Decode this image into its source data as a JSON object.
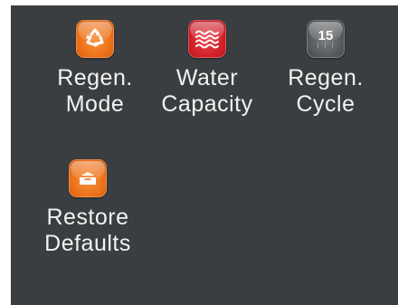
{
  "menu": {
    "items": [
      {
        "line1": "Regen.",
        "line2": "Mode",
        "icon": "recycle-icon",
        "color": "#ec6f16"
      },
      {
        "line1": "Water",
        "line2": "Capacity",
        "icon": "water-waves-icon",
        "color": "#cf1f27"
      },
      {
        "line1": "Regen.",
        "line2": "Cycle",
        "icon": "cycle-timer-icon",
        "color": "#55585b",
        "icon_text": "15"
      },
      {
        "line1": "Restore",
        "line2": "Defaults",
        "icon": "restore-box-icon",
        "color": "#ec6f16"
      }
    ]
  }
}
